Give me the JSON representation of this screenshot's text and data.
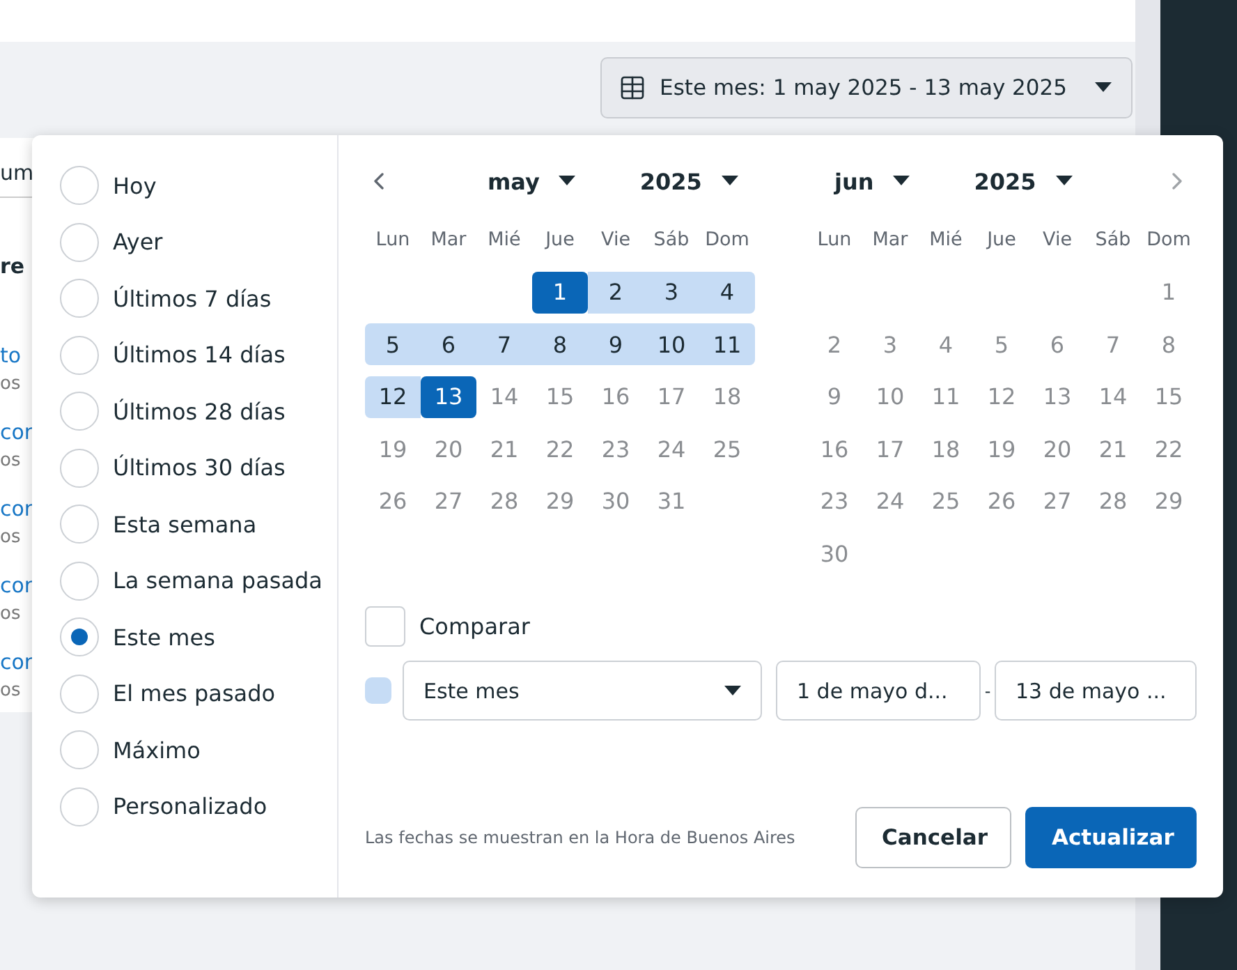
{
  "date_button": {
    "label": "Este mes: 1 may 2025 - 13 may 2025"
  },
  "background_list": [
    {
      "kind": "heading",
      "text": "um"
    },
    {
      "kind": "bold",
      "text": "re"
    },
    {
      "kind": "link",
      "text": "to"
    },
    {
      "kind": "sub",
      "text": "os"
    },
    {
      "kind": "link",
      "text": "cor"
    },
    {
      "kind": "sub",
      "text": "os"
    },
    {
      "kind": "link",
      "text": "cor"
    },
    {
      "kind": "sub",
      "text": "os"
    },
    {
      "kind": "link",
      "text": "cor"
    },
    {
      "kind": "sub",
      "text": "os"
    },
    {
      "kind": "link",
      "text": "cor"
    },
    {
      "kind": "sub",
      "text": "os"
    }
  ],
  "presets": [
    {
      "label": "Hoy",
      "selected": false
    },
    {
      "label": "Ayer",
      "selected": false
    },
    {
      "label": "Últimos 7 días",
      "selected": false
    },
    {
      "label": "Últimos 14 días",
      "selected": false
    },
    {
      "label": "Últimos 28 días",
      "selected": false
    },
    {
      "label": "Últimos 30 días",
      "selected": false
    },
    {
      "label": "Esta semana",
      "selected": false
    },
    {
      "label": "La semana pasada",
      "selected": false
    },
    {
      "label": "Este mes",
      "selected": true
    },
    {
      "label": "El mes pasado",
      "selected": false
    },
    {
      "label": "Máximo",
      "selected": false
    },
    {
      "label": "Personalizado",
      "selected": false
    }
  ],
  "months": [
    {
      "month": "may",
      "year": "2025",
      "weekdays": [
        "Lun",
        "Mar",
        "Mié",
        "Jue",
        "Vie",
        "Sáb",
        "Dom"
      ],
      "weeks": [
        [
          {
            "day": "1",
            "in_range": true,
            "endpoint": true
          },
          {
            "day": "2",
            "in_range": true,
            "endpoint": false
          },
          {
            "day": "3",
            "in_range": true,
            "endpoint": false
          },
          {
            "day": "4",
            "in_range": true,
            "endpoint": false
          }
        ],
        [
          {
            "day": "5",
            "in_range": true,
            "endpoint": false
          },
          {
            "day": "6",
            "in_range": true,
            "endpoint": false
          },
          {
            "day": "7",
            "in_range": true,
            "endpoint": false
          },
          {
            "day": "8",
            "in_range": true,
            "endpoint": false
          },
          {
            "day": "9",
            "in_range": true,
            "endpoint": false
          },
          {
            "day": "10",
            "in_range": true,
            "endpoint": false
          },
          {
            "day": "11",
            "in_range": true,
            "endpoint": false
          }
        ],
        [
          {
            "day": "12",
            "in_range": true,
            "endpoint": false
          },
          {
            "day": "13",
            "in_range": true,
            "endpoint": true
          },
          {
            "day": "14",
            "in_range": false,
            "endpoint": false
          },
          {
            "day": "15",
            "in_range": false,
            "endpoint": false
          },
          {
            "day": "16",
            "in_range": false,
            "endpoint": false
          },
          {
            "day": "17",
            "in_range": false,
            "endpoint": false
          },
          {
            "day": "18",
            "in_range": false,
            "endpoint": false
          }
        ],
        [
          {
            "day": "19",
            "in_range": false,
            "endpoint": false
          },
          {
            "day": "20",
            "in_range": false,
            "endpoint": false
          },
          {
            "day": "21",
            "in_range": false,
            "endpoint": false
          },
          {
            "day": "22",
            "in_range": false,
            "endpoint": false
          },
          {
            "day": "23",
            "in_range": false,
            "endpoint": false
          },
          {
            "day": "24",
            "in_range": false,
            "endpoint": false
          },
          {
            "day": "25",
            "in_range": false,
            "endpoint": false
          }
        ],
        [
          {
            "day": "26",
            "in_range": false,
            "endpoint": false
          },
          {
            "day": "27",
            "in_range": false,
            "endpoint": false
          },
          {
            "day": "28",
            "in_range": false,
            "endpoint": false
          },
          {
            "day": "29",
            "in_range": false,
            "endpoint": false
          },
          {
            "day": "30",
            "in_range": false,
            "endpoint": false
          },
          {
            "day": "31",
            "in_range": false,
            "endpoint": false
          }
        ]
      ]
    },
    {
      "month": "jun",
      "year": "2025",
      "weekdays": [
        "Lun",
        "Mar",
        "Mié",
        "Jue",
        "Vie",
        "Sáb",
        "Dom"
      ],
      "weeks": [
        [
          {
            "day": "1",
            "in_range": false,
            "endpoint": false
          }
        ],
        [
          {
            "day": "2",
            "in_range": false,
            "endpoint": false
          },
          {
            "day": "3",
            "in_range": false,
            "endpoint": false
          },
          {
            "day": "4",
            "in_range": false,
            "endpoint": false
          },
          {
            "day": "5",
            "in_range": false,
            "endpoint": false
          },
          {
            "day": "6",
            "in_range": false,
            "endpoint": false
          },
          {
            "day": "7",
            "in_range": false,
            "endpoint": false
          },
          {
            "day": "8",
            "in_range": false,
            "endpoint": false
          }
        ],
        [
          {
            "day": "9",
            "in_range": false,
            "endpoint": false
          },
          {
            "day": "10",
            "in_range": false,
            "endpoint": false
          },
          {
            "day": "11",
            "in_range": false,
            "endpoint": false
          },
          {
            "day": "12",
            "in_range": false,
            "endpoint": false
          },
          {
            "day": "13",
            "in_range": false,
            "endpoint": false
          },
          {
            "day": "14",
            "in_range": false,
            "endpoint": false
          },
          {
            "day": "15",
            "in_range": false,
            "endpoint": false
          }
        ],
        [
          {
            "day": "16",
            "in_range": false,
            "endpoint": false
          },
          {
            "day": "17",
            "in_range": false,
            "endpoint": false
          },
          {
            "day": "18",
            "in_range": false,
            "endpoint": false
          },
          {
            "day": "19",
            "in_range": false,
            "endpoint": false
          },
          {
            "day": "20",
            "in_range": false,
            "endpoint": false
          },
          {
            "day": "21",
            "in_range": false,
            "endpoint": false
          },
          {
            "day": "22",
            "in_range": false,
            "endpoint": false
          }
        ],
        [
          {
            "day": "23",
            "in_range": false,
            "endpoint": false
          },
          {
            "day": "24",
            "in_range": false,
            "endpoint": false
          },
          {
            "day": "25",
            "in_range": false,
            "endpoint": false
          },
          {
            "day": "26",
            "in_range": false,
            "endpoint": false
          },
          {
            "day": "27",
            "in_range": false,
            "endpoint": false
          },
          {
            "day": "28",
            "in_range": false,
            "endpoint": false
          },
          {
            "day": "29",
            "in_range": false,
            "endpoint": false
          }
        ],
        [
          {
            "day": "30",
            "in_range": false,
            "endpoint": false
          }
        ]
      ]
    }
  ],
  "compare": {
    "label": "Comparar",
    "checked": false
  },
  "range_row": {
    "color": "#c6dcf5",
    "preset": "Este mes",
    "start": "1 de mayo d...",
    "separator": "-",
    "end": "13 de mayo ..."
  },
  "footnote": "Las fechas se muestran en la Hora de Buenos Aires",
  "buttons": [
    {
      "label": "Cancelar",
      "kind": "secondary"
    },
    {
      "label": "Actualizar",
      "kind": "primary"
    }
  ]
}
